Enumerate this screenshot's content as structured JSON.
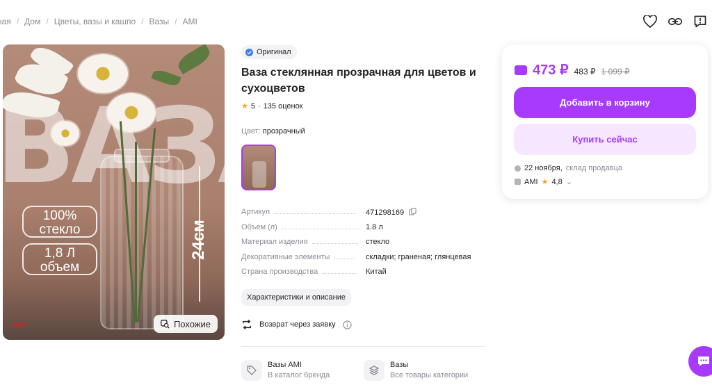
{
  "breadcrumb": [
    "ная",
    "Дом",
    "Цветы, вазы и кашпо",
    "Вазы",
    "AMI"
  ],
  "top_icons": [
    "heart-icon",
    "link-icon",
    "report-icon"
  ],
  "photo": {
    "big_text": "ВАЗА",
    "pill1": [
      "100%",
      "стекло"
    ],
    "pill2": [
      "1,8 Л",
      "объем"
    ],
    "dimension": "24см",
    "logo": "AMI",
    "similar_label": "Похожие"
  },
  "product": {
    "original_label": "Оригинал",
    "title": "Ваза стеклянная прозрачная для цветов и сухоцветов",
    "rating": "5",
    "rating_sep": "·",
    "reviews": "135 оценок",
    "color_label": "Цвет:",
    "color_value": "прозрачный"
  },
  "specs": [
    {
      "key": "Артикул",
      "value": "471298169"
    },
    {
      "key": "Объем (л)",
      "value": "1.8 л"
    },
    {
      "key": "Материал изделия",
      "value": "стекло"
    },
    {
      "key": "Декоративные элементы",
      "value": "складки; граненая; глянцевая"
    },
    {
      "key": "Страна производства",
      "value": "Китай"
    }
  ],
  "chars_button": "Характеристики и описание",
  "return_text": "Возврат через заявку",
  "brand_links": [
    {
      "title": "Вазы AMI",
      "subtitle": "В каталог бренда"
    },
    {
      "title": "Вазы",
      "subtitle": "Все товары категории"
    }
  ],
  "buy": {
    "price_main": "473 ₽",
    "price_secondary": "483 ₽",
    "price_old": "1 099 ₽",
    "add_to_cart": "Добавить в корзину",
    "buy_now": "Купить сейчас",
    "delivery_date": "22 ноября,",
    "delivery_wh": "склад продавца",
    "seller_name": "AMI",
    "seller_rating": "4,8"
  },
  "colors": {
    "accent": "#a73afd",
    "accent_light": "#f6e6ff",
    "star": "#ff9e1b"
  }
}
